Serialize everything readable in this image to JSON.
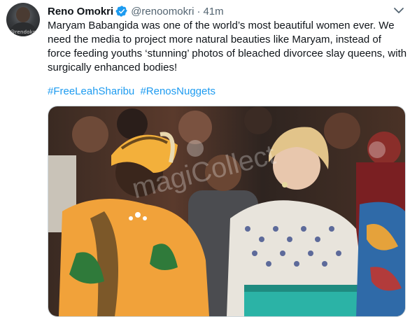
{
  "tweet": {
    "author_name": "Reno Omokri",
    "author_handle": "@renoomokri",
    "separator": "·",
    "time": "41m",
    "avatar_text": "@rendokn",
    "body": "Maryam Babangida was one of the world’s most beautiful women ever. We need the media to project more natural beauties like Maryam, instead of force feeding youths ‘stunning’ photos of bleached divorcee slay queens, with surgically enhanced bodies!",
    "hashtags": [
      "#FreeLeahSharibu",
      "#RenosNuggets"
    ],
    "watermark": "magiCollect"
  },
  "colors": {
    "accent": "#1d9bf0",
    "text": "#0f1419",
    "muted": "#536471"
  },
  "icons": [
    "verified-badge-icon",
    "chevron-down-icon"
  ]
}
